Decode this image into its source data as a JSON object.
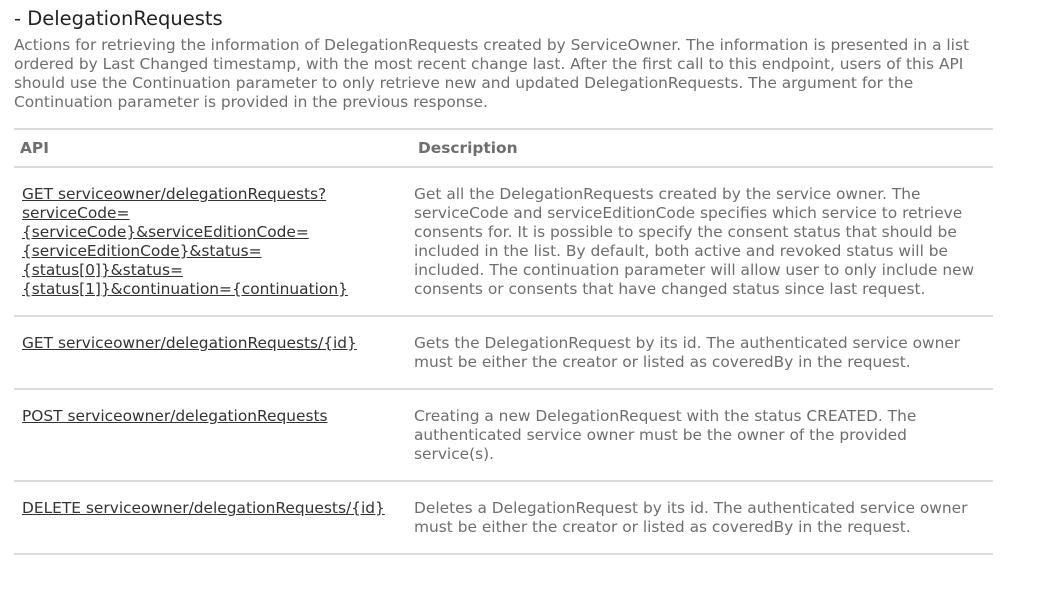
{
  "section": {
    "title": "- DelegationRequests",
    "description": "Actions for retrieving the information of DelegationRequests created by ServiceOwner. The information is presented in a list ordered by Last Changed timestamp, with the most recent change last. After the first call to this endpoint, users of this API should use the Continuation parameter to only retrieve new and updated DelegationRequests. The argument for the Continuation parameter is provided in the previous response."
  },
  "table": {
    "headers": {
      "api": "API",
      "description": "Description"
    },
    "rows": [
      {
        "api": "GET serviceowner/delegationRequests?serviceCode={serviceCode}&serviceEditionCode={serviceEditionCode}&status={status[0]}&status={status[1]}&continuation={continuation}",
        "description": "Get all the DelegationRequests created by the service owner. The serviceCode and serviceEditionCode specifies which service to retrieve consents for. It is possible to specify the consent status that should be included in the list. By default, both active and revoked status will be included. The continuation parameter will allow user to only include new consents or consents that have changed status since last request."
      },
      {
        "api": "GET serviceowner/delegationRequests/{id}",
        "description": "Gets the DelegationRequest by its id. The authenticated service owner must be either the creator or listed as coveredBy in the request."
      },
      {
        "api": "POST serviceowner/delegationRequests",
        "description": "Creating a new DelegationRequest with the status CREATED. The authenticated service owner must be the owner of the provided service(s)."
      },
      {
        "api": "DELETE serviceowner/delegationRequests/{id}",
        "description": "Deletes a DelegationRequest by its id. The authenticated service owner must be either the creator or listed as coveredBy in the request."
      }
    ]
  }
}
